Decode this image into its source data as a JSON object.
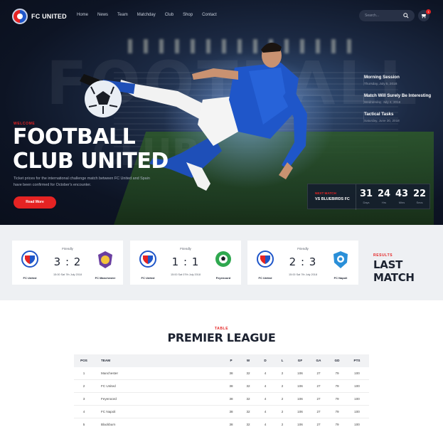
{
  "brand": {
    "name": "FC UNITED"
  },
  "nav": {
    "items": [
      "Home",
      "News",
      "Team",
      "Matchday",
      "Club",
      "Shop",
      "Contact"
    ]
  },
  "search": {
    "placeholder": "Search..."
  },
  "cart": {
    "count": "1"
  },
  "hero": {
    "background_word": "FOOTBALL",
    "background_word_2": "CLUB",
    "label": "WELCOME",
    "title": "FOOTBALL CLUB UNITED",
    "description": "Ticket prices for the international challenge match between FC United and Spain have been confirmed for October's encounter.",
    "button": "Read More"
  },
  "events": [
    {
      "title": "Morning Session",
      "date": "Thursday, July 5, 2018"
    },
    {
      "title": "Match Will Surely Be Interesting",
      "date": "Wednesday, July 4, 2018"
    },
    {
      "title": "Tactical Tasks",
      "date": "Saturday, June 30, 2018"
    }
  ],
  "countdown": {
    "label": "NEXT MATCH",
    "opponent": "VS BLUEBIRDS FC",
    "units": [
      {
        "value": "31",
        "unit": "Days"
      },
      {
        "value": "24",
        "unit": "Hrs"
      },
      {
        "value": "43",
        "unit": "Mins"
      },
      {
        "value": "22",
        "unit": "Secs"
      }
    ]
  },
  "results": {
    "label": "RESULTS",
    "title": "LAST MATCH",
    "matches": [
      {
        "type": "Friendly",
        "score": "3 : 2",
        "date": "15:00 Sat 7th July 2018",
        "home": "FC United",
        "away": "FC Manchester"
      },
      {
        "type": "Friendly",
        "score": "1 : 1",
        "date": "15:00 Sat 07th July 2018",
        "home": "FC United",
        "away": "Feyenoord"
      },
      {
        "type": "Friendly",
        "score": "2 : 3",
        "date": "15:00 Sat 7th July 2018",
        "home": "FC United",
        "away": "FC Napoli"
      }
    ]
  },
  "league": {
    "label": "TABLE",
    "title": "PREMIER LEAGUE",
    "columns": [
      "POS",
      "TEAM",
      "P",
      "W",
      "D",
      "L",
      "GF",
      "GA",
      "GD",
      "PTS"
    ],
    "rows": [
      [
        "1",
        "Manchester",
        "38",
        "32",
        "4",
        "2",
        "106",
        "27",
        "79",
        "100"
      ],
      [
        "2",
        "FC United",
        "38",
        "32",
        "4",
        "2",
        "106",
        "27",
        "79",
        "100"
      ],
      [
        "3",
        "Feyenoord",
        "38",
        "32",
        "4",
        "2",
        "106",
        "27",
        "79",
        "100"
      ],
      [
        "4",
        "FC Napoli",
        "38",
        "32",
        "4",
        "2",
        "106",
        "27",
        "79",
        "100"
      ],
      [
        "5",
        "Blackburn",
        "38",
        "32",
        "4",
        "2",
        "106",
        "27",
        "79",
        "100"
      ]
    ]
  },
  "colors": {
    "accent": "#e52323",
    "dark": "#0d1424",
    "text": "#1c2230"
  }
}
